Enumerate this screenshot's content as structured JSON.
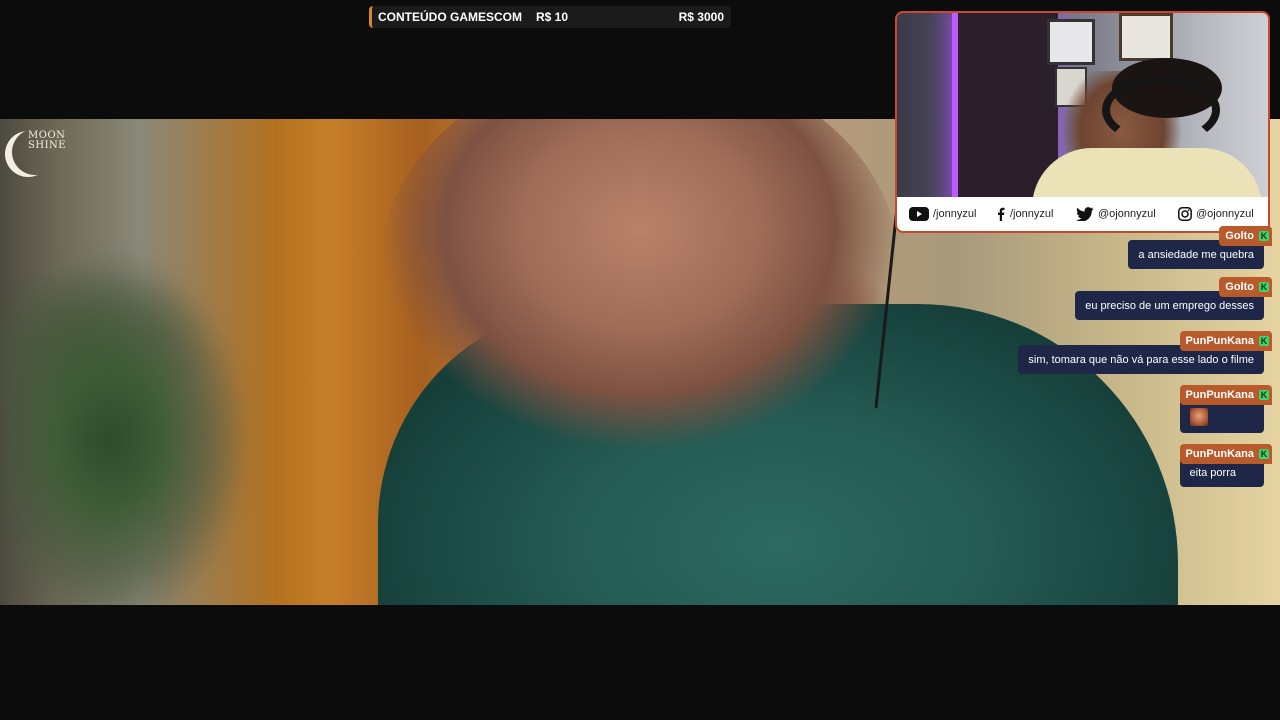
{
  "goal": {
    "title": "CONTEÚDO GAMESCOM",
    "current": "R$ 10",
    "target": "R$ 3000"
  },
  "logo": {
    "line1": "MOON",
    "line2": "SHINE"
  },
  "socials": {
    "youtube": "/jonnyzul",
    "facebook": "/jonnyzul",
    "twitter": "@ojonnyzul",
    "instagram": "@ojonnyzul"
  },
  "chat": [
    {
      "user": "Golto",
      "text": "a ansiedade me quebra"
    },
    {
      "user": "Golto",
      "text": "eu preciso de um emprego desses"
    },
    {
      "user": "PunPunKana",
      "text": "sim, tomara que não vá para esse lado o filme"
    },
    {
      "user": "PunPunKana",
      "text": "",
      "emote": "emote-icon"
    },
    {
      "user": "PunPunKana",
      "text": "eita porra"
    }
  ],
  "colors": {
    "goal_accent": "#d88a22",
    "name_tag": "#b85a2c",
    "message_bg": "#1e2747",
    "webcam_border": "#c94a2a",
    "badge": "#3fd36b"
  }
}
